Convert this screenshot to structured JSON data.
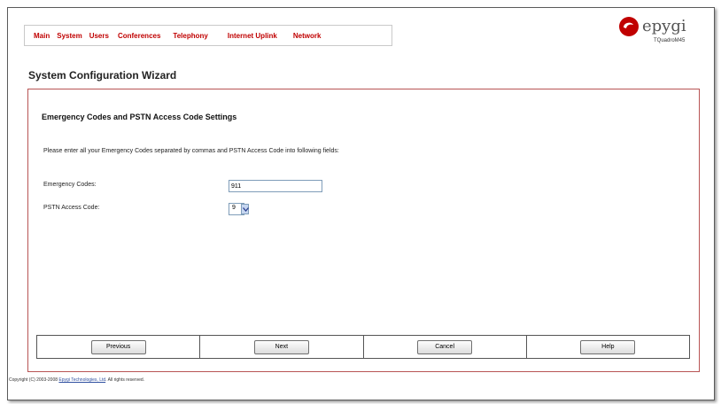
{
  "nav": {
    "items": [
      {
        "label": "Main"
      },
      {
        "label": "System"
      },
      {
        "label": "Users"
      },
      {
        "label": "Conferences"
      },
      {
        "label": "Telephony"
      },
      {
        "label": "Internet Uplink"
      },
      {
        "label": "Network"
      }
    ]
  },
  "brand": {
    "logo_text": "epygi",
    "model": "TQuadroM45",
    "accent_color": "#c00000"
  },
  "page": {
    "title": "System Configuration Wizard"
  },
  "section": {
    "title": "Emergency Codes and PSTN Access Code Settings",
    "instructions": "Please enter all your Emergency Codes separated by commas and PSTN Access Code into following fields:"
  },
  "fields": {
    "emergency_codes": {
      "label": "Emergency Codes:",
      "value": "911"
    },
    "pstn_access_code": {
      "label": "PSTN Access Code:",
      "value": "9"
    }
  },
  "buttons": {
    "previous": "Previous",
    "next": "Next",
    "cancel": "Cancel",
    "help": "Help"
  },
  "footer": {
    "prefix": "Copyright (C) 2003-2008 ",
    "company": "Epygi Technologies, Ltd",
    "suffix": ". All rights reserved."
  }
}
